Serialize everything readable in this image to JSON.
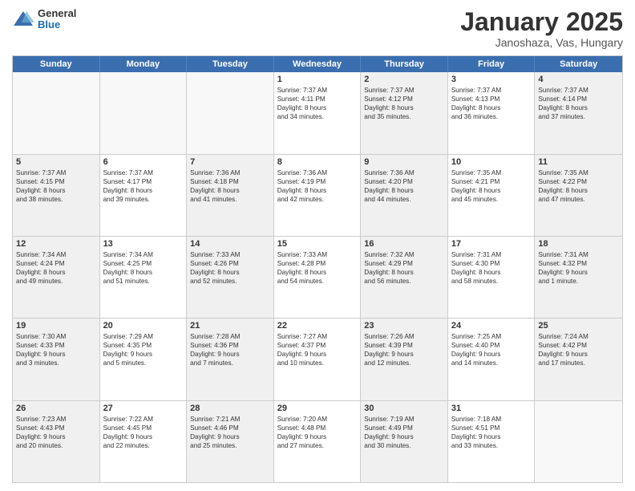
{
  "header": {
    "logo_general": "General",
    "logo_blue": "Blue",
    "month_title": "January 2025",
    "subtitle": "Janoshaza, Vas, Hungary"
  },
  "weekdays": [
    "Sunday",
    "Monday",
    "Tuesday",
    "Wednesday",
    "Thursday",
    "Friday",
    "Saturday"
  ],
  "rows": [
    [
      {
        "day": "",
        "text": "",
        "empty": true
      },
      {
        "day": "",
        "text": "",
        "empty": true
      },
      {
        "day": "",
        "text": "",
        "empty": true
      },
      {
        "day": "1",
        "text": "Sunrise: 7:37 AM\nSunset: 4:11 PM\nDaylight: 8 hours\nand 34 minutes.",
        "shaded": false
      },
      {
        "day": "2",
        "text": "Sunrise: 7:37 AM\nSunset: 4:12 PM\nDaylight: 8 hours\nand 35 minutes.",
        "shaded": true
      },
      {
        "day": "3",
        "text": "Sunrise: 7:37 AM\nSunset: 4:13 PM\nDaylight: 8 hours\nand 36 minutes.",
        "shaded": false
      },
      {
        "day": "4",
        "text": "Sunrise: 7:37 AM\nSunset: 4:14 PM\nDaylight: 8 hours\nand 37 minutes.",
        "shaded": true
      }
    ],
    [
      {
        "day": "5",
        "text": "Sunrise: 7:37 AM\nSunset: 4:15 PM\nDaylight: 8 hours\nand 38 minutes.",
        "shaded": true
      },
      {
        "day": "6",
        "text": "Sunrise: 7:37 AM\nSunset: 4:17 PM\nDaylight: 8 hours\nand 39 minutes.",
        "shaded": false
      },
      {
        "day": "7",
        "text": "Sunrise: 7:36 AM\nSunset: 4:18 PM\nDaylight: 8 hours\nand 41 minutes.",
        "shaded": true
      },
      {
        "day": "8",
        "text": "Sunrise: 7:36 AM\nSunset: 4:19 PM\nDaylight: 8 hours\nand 42 minutes.",
        "shaded": false
      },
      {
        "day": "9",
        "text": "Sunrise: 7:36 AM\nSunset: 4:20 PM\nDaylight: 8 hours\nand 44 minutes.",
        "shaded": true
      },
      {
        "day": "10",
        "text": "Sunrise: 7:35 AM\nSunset: 4:21 PM\nDaylight: 8 hours\nand 45 minutes.",
        "shaded": false
      },
      {
        "day": "11",
        "text": "Sunrise: 7:35 AM\nSunset: 4:22 PM\nDaylight: 8 hours\nand 47 minutes.",
        "shaded": true
      }
    ],
    [
      {
        "day": "12",
        "text": "Sunrise: 7:34 AM\nSunset: 4:24 PM\nDaylight: 8 hours\nand 49 minutes.",
        "shaded": true
      },
      {
        "day": "13",
        "text": "Sunrise: 7:34 AM\nSunset: 4:25 PM\nDaylight: 8 hours\nand 51 minutes.",
        "shaded": false
      },
      {
        "day": "14",
        "text": "Sunrise: 7:33 AM\nSunset: 4:26 PM\nDaylight: 8 hours\nand 52 minutes.",
        "shaded": true
      },
      {
        "day": "15",
        "text": "Sunrise: 7:33 AM\nSunset: 4:28 PM\nDaylight: 8 hours\nand 54 minutes.",
        "shaded": false
      },
      {
        "day": "16",
        "text": "Sunrise: 7:32 AM\nSunset: 4:29 PM\nDaylight: 8 hours\nand 56 minutes.",
        "shaded": true
      },
      {
        "day": "17",
        "text": "Sunrise: 7:31 AM\nSunset: 4:30 PM\nDaylight: 8 hours\nand 58 minutes.",
        "shaded": false
      },
      {
        "day": "18",
        "text": "Sunrise: 7:31 AM\nSunset: 4:32 PM\nDaylight: 9 hours\nand 1 minute.",
        "shaded": true
      }
    ],
    [
      {
        "day": "19",
        "text": "Sunrise: 7:30 AM\nSunset: 4:33 PM\nDaylight: 9 hours\nand 3 minutes.",
        "shaded": true
      },
      {
        "day": "20",
        "text": "Sunrise: 7:29 AM\nSunset: 4:35 PM\nDaylight: 9 hours\nand 5 minutes.",
        "shaded": false
      },
      {
        "day": "21",
        "text": "Sunrise: 7:28 AM\nSunset: 4:36 PM\nDaylight: 9 hours\nand 7 minutes.",
        "shaded": true
      },
      {
        "day": "22",
        "text": "Sunrise: 7:27 AM\nSunset: 4:37 PM\nDaylight: 9 hours\nand 10 minutes.",
        "shaded": false
      },
      {
        "day": "23",
        "text": "Sunrise: 7:26 AM\nSunset: 4:39 PM\nDaylight: 9 hours\nand 12 minutes.",
        "shaded": true
      },
      {
        "day": "24",
        "text": "Sunrise: 7:25 AM\nSunset: 4:40 PM\nDaylight: 9 hours\nand 14 minutes.",
        "shaded": false
      },
      {
        "day": "25",
        "text": "Sunrise: 7:24 AM\nSunset: 4:42 PM\nDaylight: 9 hours\nand 17 minutes.",
        "shaded": true
      }
    ],
    [
      {
        "day": "26",
        "text": "Sunrise: 7:23 AM\nSunset: 4:43 PM\nDaylight: 9 hours\nand 20 minutes.",
        "shaded": true
      },
      {
        "day": "27",
        "text": "Sunrise: 7:22 AM\nSunset: 4:45 PM\nDaylight: 9 hours\nand 22 minutes.",
        "shaded": false
      },
      {
        "day": "28",
        "text": "Sunrise: 7:21 AM\nSunset: 4:46 PM\nDaylight: 9 hours\nand 25 minutes.",
        "shaded": true
      },
      {
        "day": "29",
        "text": "Sunrise: 7:20 AM\nSunset: 4:48 PM\nDaylight: 9 hours\nand 27 minutes.",
        "shaded": false
      },
      {
        "day": "30",
        "text": "Sunrise: 7:19 AM\nSunset: 4:49 PM\nDaylight: 9 hours\nand 30 minutes.",
        "shaded": true
      },
      {
        "day": "31",
        "text": "Sunrise: 7:18 AM\nSunset: 4:51 PM\nDaylight: 9 hours\nand 33 minutes.",
        "shaded": false
      },
      {
        "day": "",
        "text": "",
        "empty": true
      }
    ]
  ]
}
